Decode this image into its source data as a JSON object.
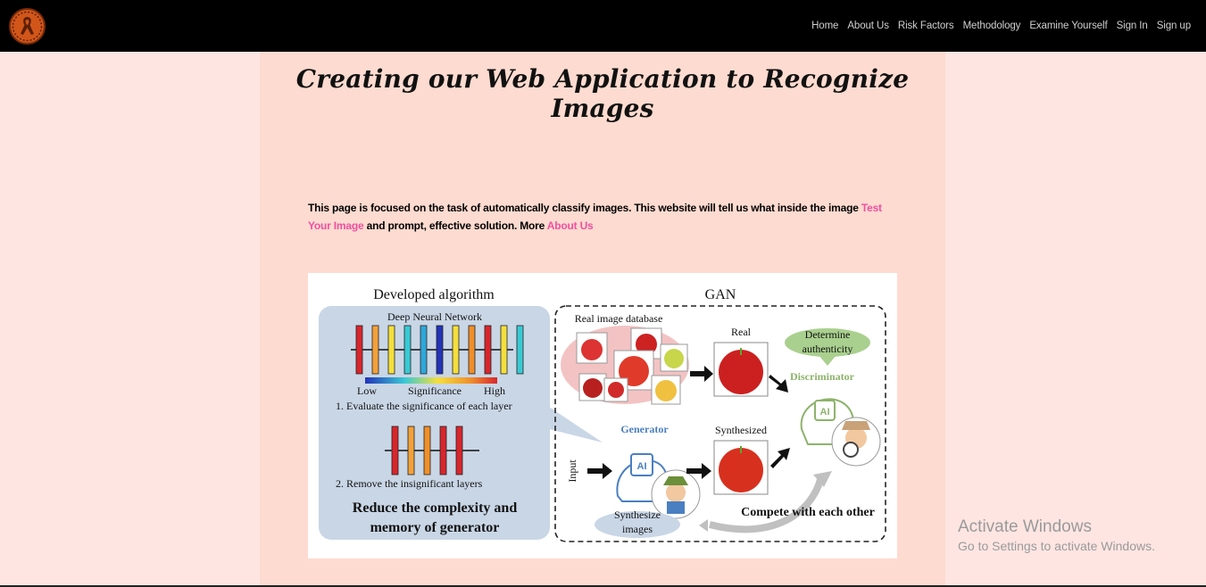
{
  "nav": {
    "logo": "ribbon-logo",
    "items": [
      "Home",
      "About Us",
      "Risk Factors",
      "Methodology",
      "Examine Yourself",
      "Sign In",
      "Sign up"
    ]
  },
  "main": {
    "title": "Creating our Web Application to Recognize Images",
    "intro_text_1": "This page is focused on the task of automatically classify images. This website will tell us what inside the image ",
    "intro_link_1": "Test Your Image",
    "intro_text_2": " and prompt, effective solution. More ",
    "intro_link_2": "About Us"
  },
  "figure": {
    "left_title": "Developed algorithm",
    "right_title": "GAN",
    "dnn_label": "Deep Neural Network",
    "low": "Low",
    "significance": "Significance",
    "high": "High",
    "step1": "1. Evaluate the significance of each layer",
    "step2": "2. Remove the insignificant layers",
    "reduce_1": "Reduce the complexity and",
    "reduce_2": "memory of generator",
    "real_db": "Real image database",
    "real": "Real",
    "determine_1": "Determine",
    "determine_2": "authenticity",
    "discriminator": "Discriminator",
    "generator": "Generator",
    "synthesized": "Synthesized",
    "input": "Input",
    "synth_1": "Synthesize",
    "synth_2": "images",
    "compete": "Compete with each other",
    "ai": "AI"
  },
  "watermark": {
    "line1": "Activate Windows",
    "line2": "Go to Settings to activate Windows."
  },
  "colors": {
    "navbar": "#000000",
    "page_bg": "#fee5e2",
    "panel_bg": "#fedbd0",
    "link": "#f04fa0"
  }
}
